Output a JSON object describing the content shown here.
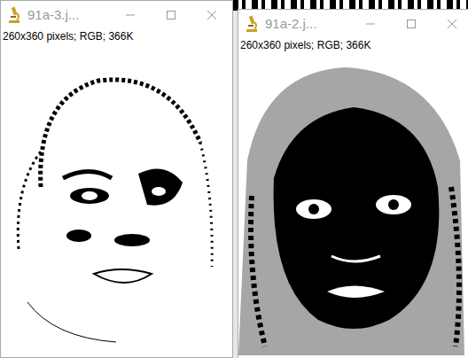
{
  "windows": [
    {
      "title": "91a-3.j...",
      "info": "260x360 pixels; RGB; 366K"
    },
    {
      "title": "91a-2.j...",
      "info": "260x360 pixels; RGB; 366K"
    }
  ]
}
